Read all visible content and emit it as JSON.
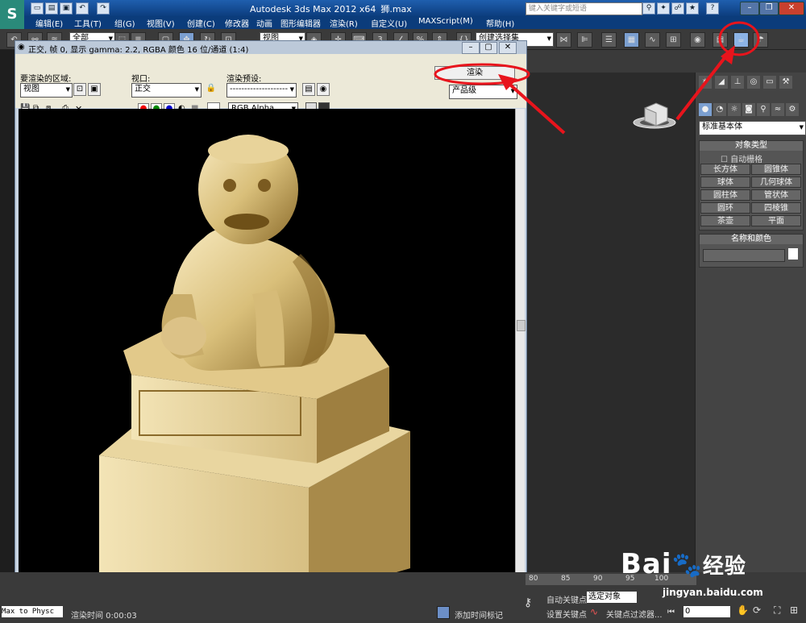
{
  "app": {
    "title": "Autodesk 3ds Max  2012 x64",
    "file": "狮.max",
    "search_placeholder": "键入关键字或短语",
    "logo": "S"
  },
  "menu": [
    "编辑(E)",
    "工具(T)",
    "组(G)",
    "视图(V)",
    "创建(C)",
    "修改器",
    "动画",
    "图形编辑器",
    "渲染(R)",
    "自定义(U)",
    "MAXScript(M)",
    "帮助(H)"
  ],
  "toolbar": {
    "selection_filter": "全部",
    "ref_coord": "视图",
    "named_selection": "创建选择集"
  },
  "render_window": {
    "title": "正交, 帧 0, 显示 gamma: 2.2, RGBA 颜色 16 位/通道 (1:4)",
    "area_label": "要渲染的区域:",
    "area_value": "视图",
    "viewport_label": "视口:",
    "viewport_value": "正交",
    "preset_label": "渲染预设:",
    "preset_value": "--------------------",
    "render_button": "渲染",
    "render_mode": "产品级",
    "channel": "RGB Alpha"
  },
  "command_panel": {
    "category": "标准基本体",
    "object_type_header": "对象类型",
    "autogrid": "自动栅格",
    "objects": [
      "长方体",
      "圆锥体",
      "球体",
      "几何球体",
      "圆柱体",
      "管状体",
      "圆环",
      "四棱锥",
      "茶壶",
      "平面"
    ],
    "name_color_header": "名称和颜色"
  },
  "status": {
    "script_box": "Max to Physc",
    "render_time": "渲染时间  0:00:03",
    "add_time_tag": "添加时间标记",
    "auto_key": "自动关键点",
    "set_key": "设置关键点",
    "selected": "选定对象",
    "key_filters": "关键点过滤器...",
    "frame": "0",
    "ticks": [
      "80",
      "85",
      "90",
      "95",
      "100"
    ]
  },
  "watermark": {
    "brand": "Bai",
    "brand2": "经验",
    "url": "jingyan.baidu.com"
  },
  "colors": {
    "annotation": "#e8141c",
    "statue": "#d9bf7a"
  }
}
